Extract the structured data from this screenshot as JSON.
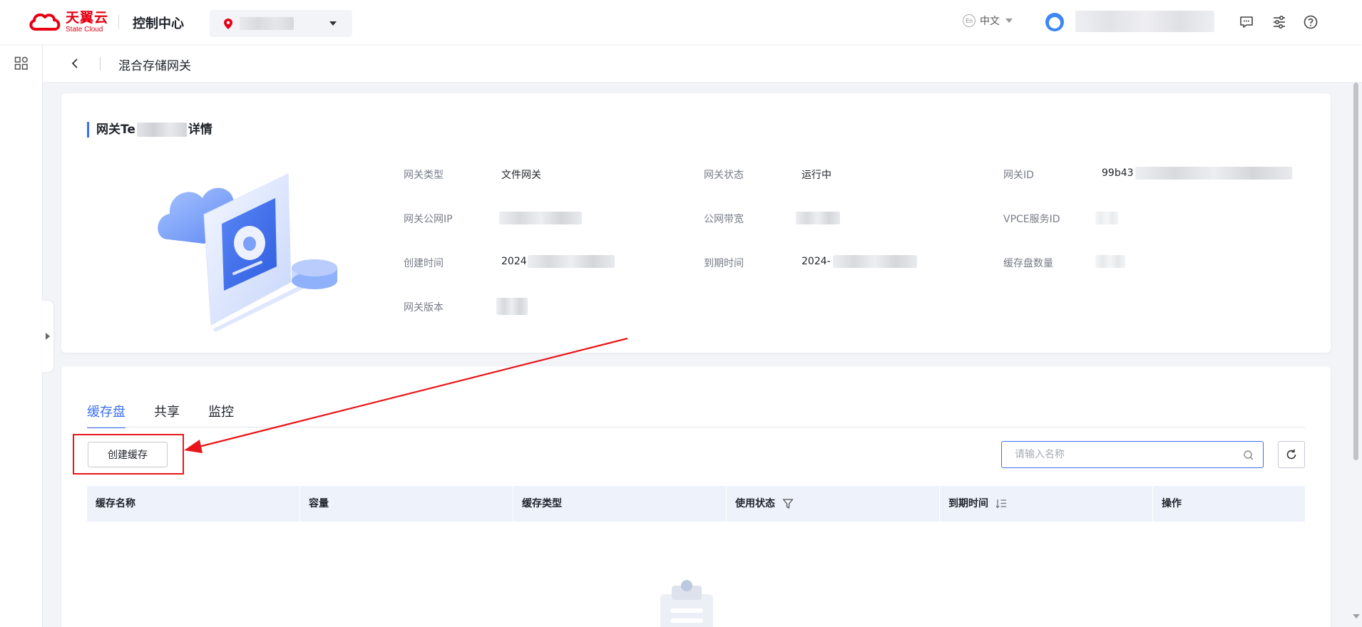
{
  "topbar": {
    "logo_cn": "天翼云",
    "logo_en": "State Cloud",
    "console_title": "控制中心",
    "language": "中文",
    "lang_icon_text": "En"
  },
  "page": {
    "title": "混合存储网关"
  },
  "detail": {
    "title_prefix": "网关Te",
    "title_suffix": "详情",
    "fields": {
      "gateway_type_label": "网关类型",
      "gateway_type_value": "文件网关",
      "gateway_status_label": "网关状态",
      "gateway_status_value": "运行中",
      "gateway_id_label": "网关ID",
      "gateway_id_value": "99b43",
      "public_ip_label": "网关公网IP",
      "bandwidth_label": "公网带宽",
      "vpce_label": "VPCE服务ID",
      "created_label": "创建时间",
      "created_value": "2024",
      "expire_label": "到期时间",
      "expire_value": "2024-",
      "cache_count_label": "缓存盘数量",
      "version_label": "网关版本"
    }
  },
  "tabs": [
    {
      "label": "缓存盘",
      "active": true
    },
    {
      "label": "共享",
      "active": false
    },
    {
      "label": "监控",
      "active": false
    }
  ],
  "toolbar": {
    "create_label": "创建缓存",
    "search_placeholder": "请输入名称"
  },
  "table": {
    "columns": [
      "缓存名称",
      "容量",
      "缓存类型",
      "使用状态",
      "到期时间",
      "操作"
    ]
  },
  "colors": {
    "brand_red": "#e60012",
    "accent_blue": "#3d6ff2",
    "annotation_red": "#e8161a"
  }
}
